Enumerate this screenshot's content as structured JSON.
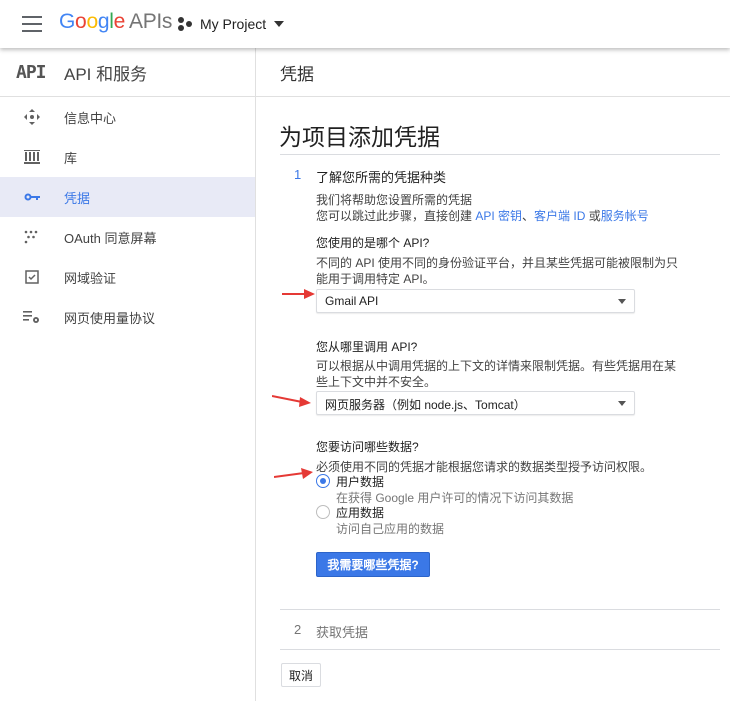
{
  "topbar": {
    "logo_google": [
      "G",
      "o",
      "o",
      "g",
      "l",
      "e"
    ],
    "logo_apis": "APIs",
    "project_name": "My Project"
  },
  "sidebar": {
    "badge": "API",
    "title": "API 和服务",
    "items": [
      {
        "label": "信息中心",
        "icon": "dashboard-icon",
        "active": false
      },
      {
        "label": "库",
        "icon": "library-icon",
        "active": false
      },
      {
        "label": "凭据",
        "icon": "key-icon",
        "active": true
      },
      {
        "label": "OAuth 同意屏幕",
        "icon": "consent-icon",
        "active": false
      },
      {
        "label": "网域验证",
        "icon": "checkbox-icon",
        "active": false
      },
      {
        "label": "网页使用量协议",
        "icon": "settings-list-icon",
        "active": false
      }
    ]
  },
  "main": {
    "header": "凭据",
    "page_title": "为项目添加凭据",
    "step1": {
      "number": "1",
      "title": "了解您所需的凭据种类",
      "intro_line1": "我们将帮助您设置所需的凭据",
      "intro_line2_prefix": "您可以跳过此步骤，直接创建 ",
      "link_api_key": "API 密钥",
      "sep1": "、",
      "link_client_id": "客户端 ID",
      "sep2": " 或",
      "link_service_account": "服务帐号",
      "q1": {
        "question": "您使用的是哪个 API?",
        "desc_line1": "不同的 API 使用不同的身份验证平台，并且某些凭据可能被限制为只",
        "desc_line2": "能用于调用特定 API。",
        "value": "Gmail API"
      },
      "q2": {
        "question": "您从哪里调用 API?",
        "desc_line1": "可以根据从中调用凭据的上下文的详情来限制凭据。有些凭据用在某",
        "desc_line2": "些上下文中并不安全。",
        "value": "网页服务器（例如 node.js、Tomcat）"
      },
      "q3": {
        "question": "您要访问哪些数据?",
        "desc": "必须使用不同的凭据才能根据您请求的数据类型授予访问权限。",
        "options": [
          {
            "label": "用户数据",
            "desc": "在获得 Google 用户许可的情况下访问其数据",
            "selected": true
          },
          {
            "label": "应用数据",
            "desc": "访问自己应用的数据",
            "selected": false
          }
        ]
      },
      "button": "我需要哪些凭据?"
    },
    "step2": {
      "number": "2",
      "title": "获取凭据"
    },
    "cancel": "取消"
  },
  "colors": {
    "accent": "#3b78e7",
    "arrow": "#e53935",
    "active_bg": "#e8eaf6"
  }
}
